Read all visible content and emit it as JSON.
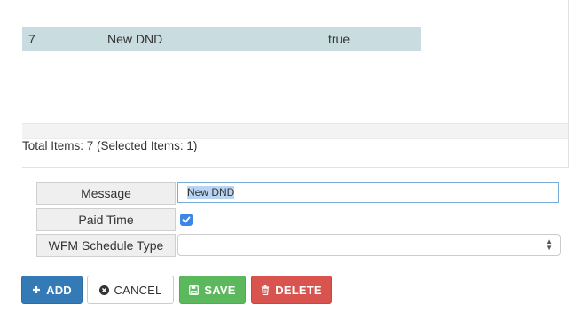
{
  "grid": {
    "rows": [
      {
        "id": "7",
        "name": "New DND",
        "paid": "true"
      }
    ],
    "footer_text": "Total Items: 7 (Selected Items: 1)"
  },
  "form": {
    "message_label": "Message",
    "message_value": "New DND",
    "paid_time_label": "Paid Time",
    "paid_time_checked": true,
    "wfm_label": "WFM Schedule Type",
    "wfm_value": ""
  },
  "buttons": {
    "add": "ADD",
    "cancel": "CANCEL",
    "save": "SAVE",
    "delete": "DELETE"
  },
  "colors": {
    "selected_row": "#c9dde0",
    "add": "#337ab7",
    "save": "#5cb85c",
    "delete": "#d9534f",
    "checkbox": "#3c86e6"
  },
  "icons": {
    "add": "plus-icon",
    "cancel": "times-circle-icon",
    "save": "floppy-disk-icon",
    "delete": "trash-icon"
  }
}
